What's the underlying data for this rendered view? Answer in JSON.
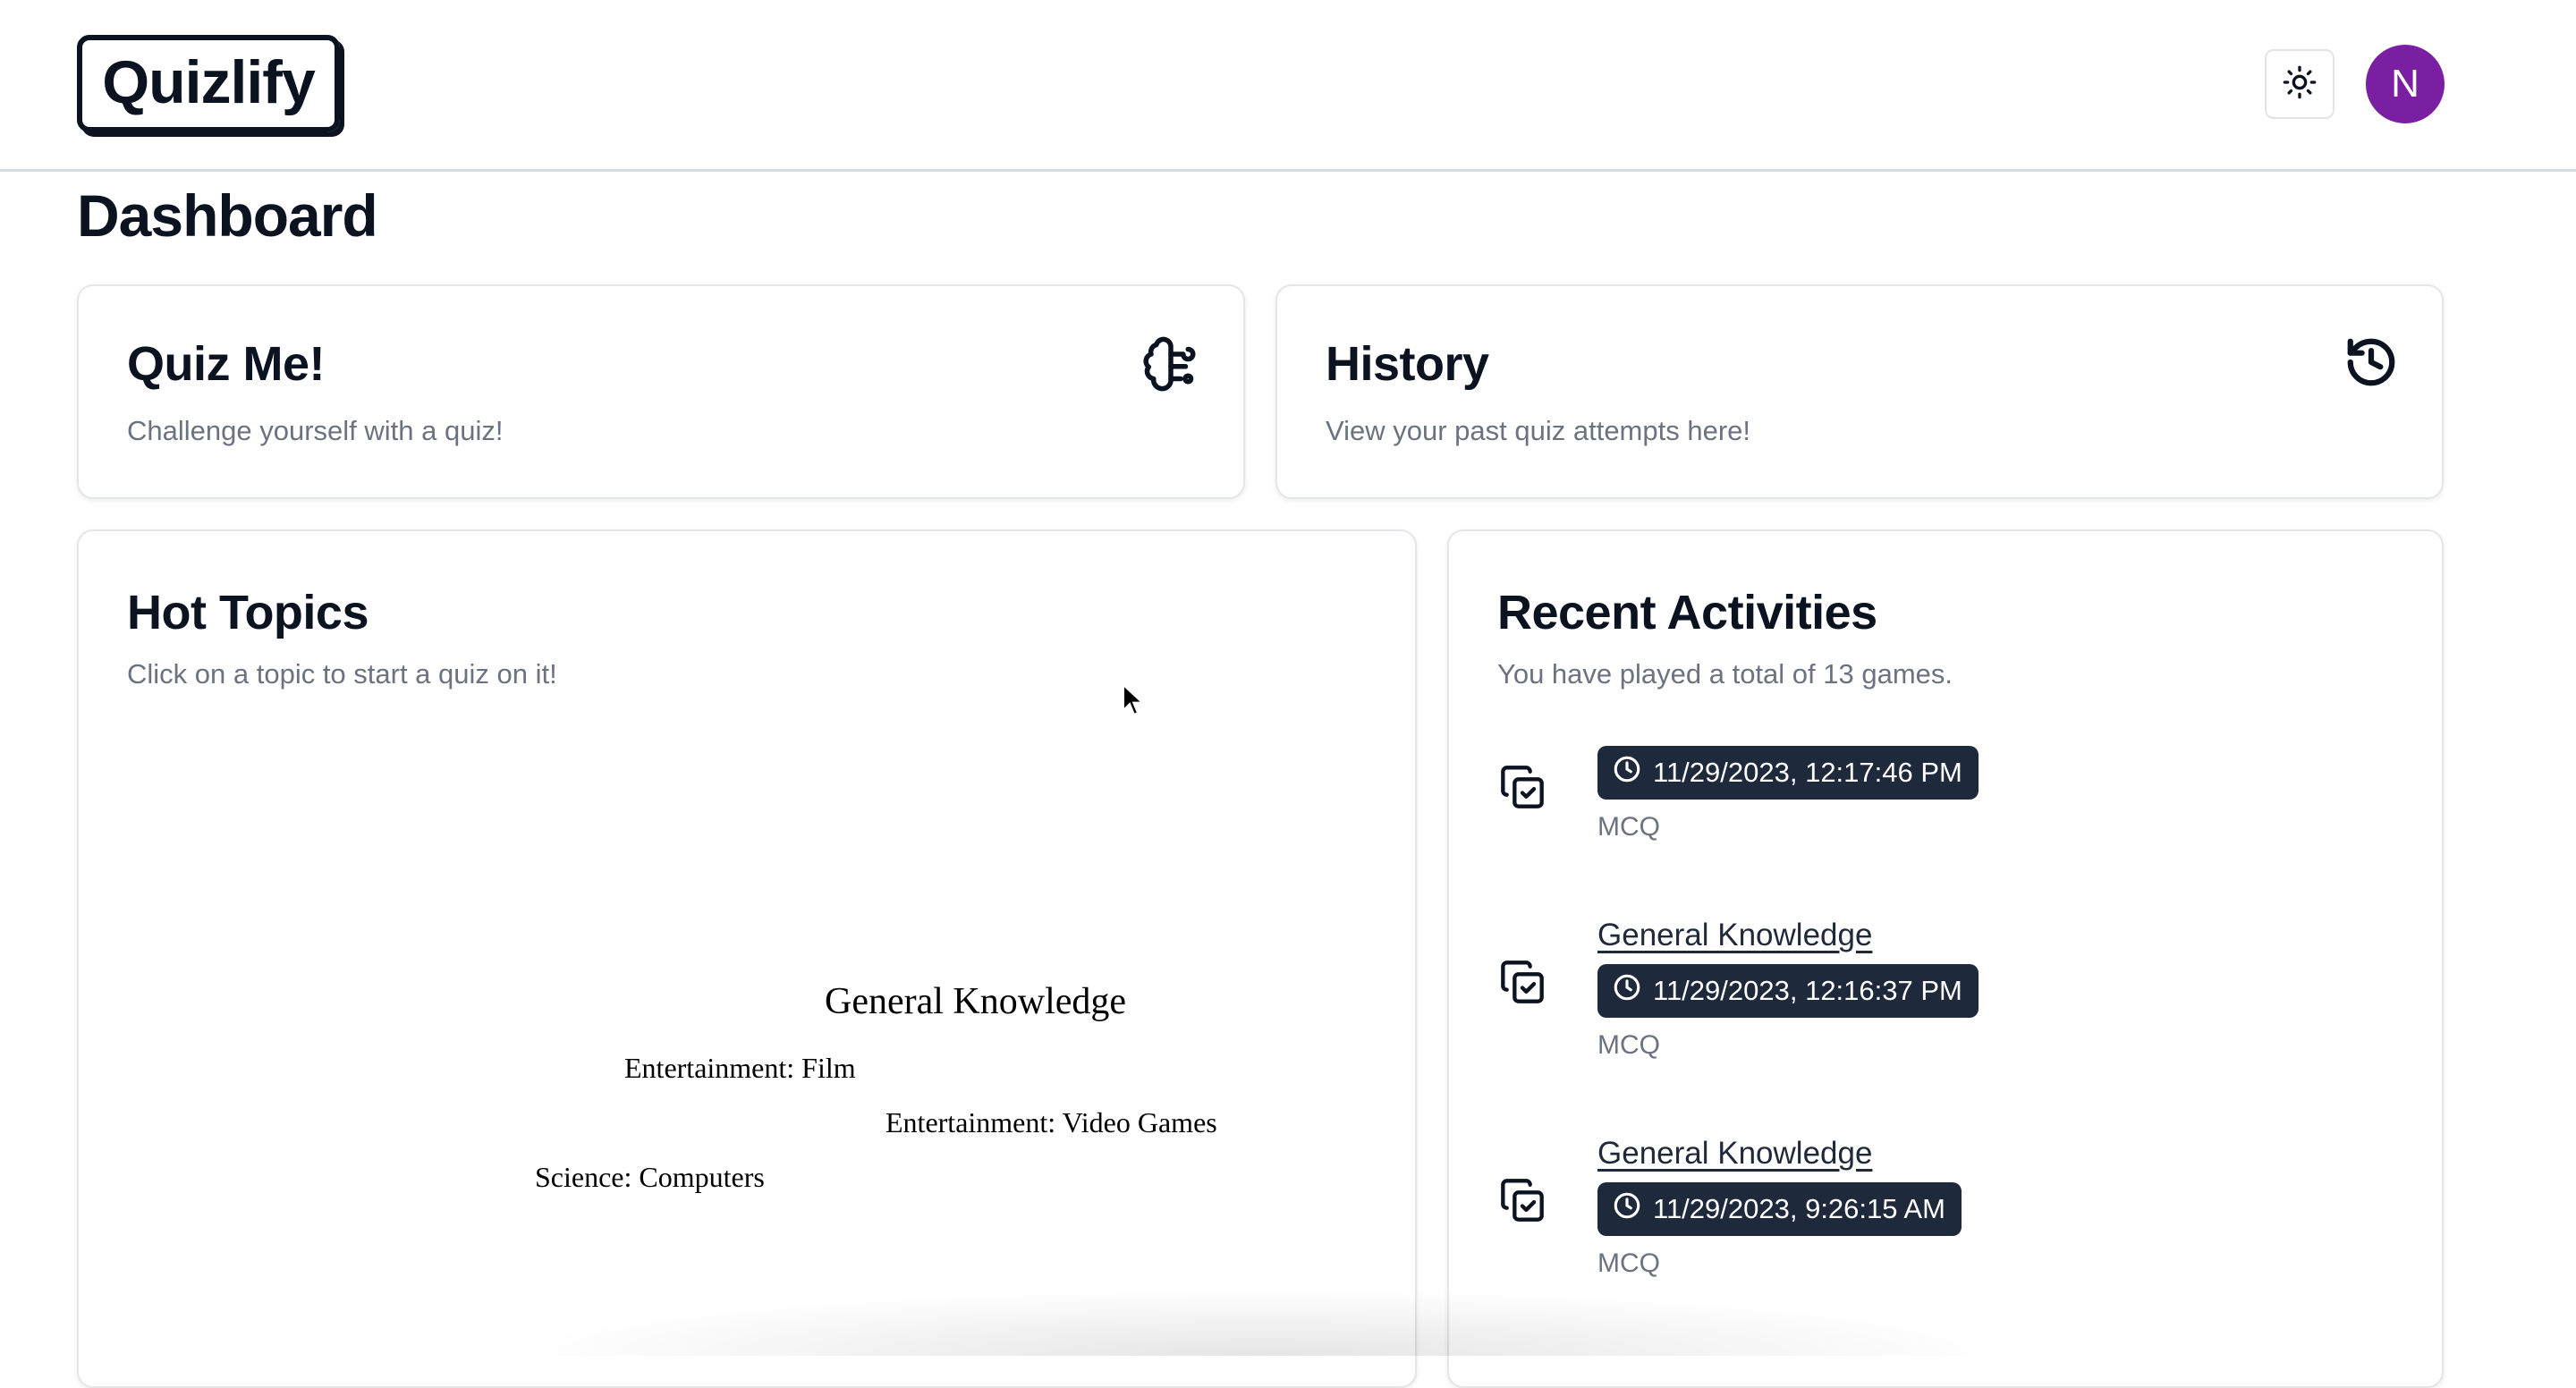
{
  "header": {
    "logo_text": "Quizlify",
    "theme_toggle_icon": "sun-icon",
    "avatar_initial": "N",
    "avatar_color": "#7b1fa2"
  },
  "page": {
    "title": "Dashboard"
  },
  "quiz_card": {
    "title": "Quiz Me!",
    "subtitle": "Challenge yourself with a quiz!",
    "icon": "brain-icon"
  },
  "history_card": {
    "title": "History",
    "subtitle": "View your past quiz attempts here!",
    "icon": "history-icon"
  },
  "hot_topics": {
    "title": "Hot Topics",
    "subtitle": "Click on a topic to start a quiz on it!",
    "topics": [
      "General Knowledge",
      "Entertainment: Film",
      "Entertainment: Video Games",
      "Science: Computers"
    ]
  },
  "recent_activities": {
    "title": "Recent Activities",
    "subtitle": "You have played a total of 13 games.",
    "items": [
      {
        "topic": "",
        "timestamp": "11/29/2023, 12:17:46 PM",
        "type": "MCQ"
      },
      {
        "topic": "General Knowledge",
        "timestamp": "11/29/2023, 12:16:37 PM",
        "type": "MCQ"
      },
      {
        "topic": "General Knowledge",
        "timestamp": "11/29/2023, 9:26:15 AM",
        "type": "MCQ"
      }
    ]
  },
  "colors": {
    "badge_bg": "#1e293b",
    "muted_text": "#6b7280",
    "border": "#e4e6ea"
  }
}
